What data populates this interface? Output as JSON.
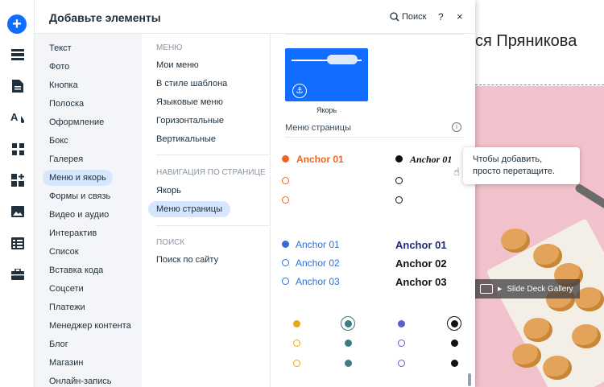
{
  "panel": {
    "title": "Добавьте элементы",
    "search_label": "Поиск",
    "help_label": "?",
    "close_label": "×"
  },
  "categories": [
    {
      "label": "Текст"
    },
    {
      "label": "Фото"
    },
    {
      "label": "Кнопка"
    },
    {
      "label": "Полоска"
    },
    {
      "label": "Оформление"
    },
    {
      "label": "Бокс"
    },
    {
      "label": "Галерея"
    },
    {
      "label": "Меню и якорь",
      "selected": true
    },
    {
      "label": "Формы и связь"
    },
    {
      "label": "Видео и аудио"
    },
    {
      "label": "Интерактив"
    },
    {
      "label": "Список"
    },
    {
      "label": "Вставка кода"
    },
    {
      "label": "Соцсети"
    },
    {
      "label": "Платежи"
    },
    {
      "label": "Менеджер контента"
    },
    {
      "label": "Блог"
    },
    {
      "label": "Магазин"
    },
    {
      "label": "Онлайн-запись"
    }
  ],
  "subnav": {
    "menu_header": "МЕНЮ",
    "menu_items": [
      "Мои меню",
      "В стиле шаблона",
      "Языковые меню",
      "Горизонтальные",
      "Вертикальные"
    ],
    "anchors_header": "НАВИГАЦИЯ ПО СТРАНИЦЕ",
    "anchor_items": [
      "Якорь",
      "Меню страницы"
    ],
    "search_header": "ПОИСК",
    "search_items": [
      "Поиск по сайту"
    ]
  },
  "content": {
    "anchor_thumb_label": "Якорь",
    "page_menu_label": "Меню страницы",
    "info_glyph": "i",
    "samples": {
      "a1": "Anchor 01",
      "b1": "Anchor 01",
      "c1": "Anchor 01",
      "c2": "Anchor 02",
      "c3": "Anchor 03",
      "d1": "Anchor 01",
      "d2": "Anchor 02",
      "d3": "Anchor 03"
    }
  },
  "tooltip": {
    "text": "Чтобы добавить, просто перетащите."
  },
  "background": {
    "heading": "ся Пряникова",
    "gallery_tag": "Slide Deck Gallery"
  },
  "colors": {
    "accent": "#116dff",
    "selected_bg": "#d6e6fe",
    "orange": "#f26322",
    "blue": "#2f6fd6",
    "navy": "#1c2a78",
    "yellow": "#e6a817",
    "teal": "#3f7b82",
    "purple": "#5a5fc8",
    "black": "#111111"
  }
}
